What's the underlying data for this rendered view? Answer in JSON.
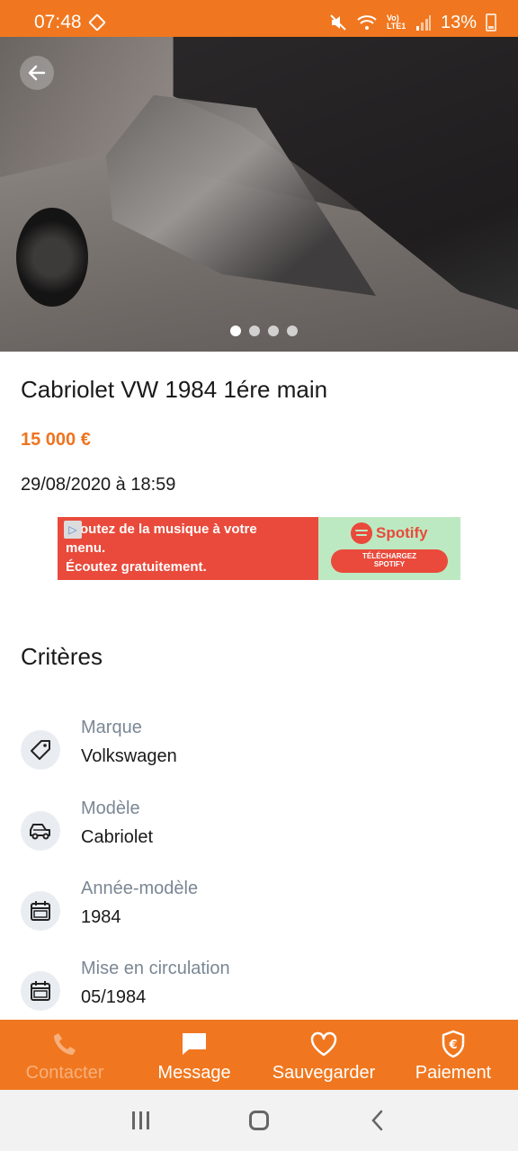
{
  "status_bar": {
    "time": "07:48",
    "battery": "13%",
    "network": "Vo) LTE1",
    "icons": [
      "mute-icon",
      "wifi-icon",
      "signal-icon",
      "battery-icon"
    ]
  },
  "gallery": {
    "image_count": 4,
    "active_index": 0
  },
  "listing": {
    "title": "Cabriolet VW 1984 1ére main",
    "price": "15 000 €",
    "date": "29/08/2020 à 18:59"
  },
  "ad": {
    "line1": "outez de la musique à votre",
    "line2": "menu.",
    "line3": "Écoutez gratuitement.",
    "brand": "Spotify",
    "cta_line1": "TÉLÉCHARGEZ",
    "cta_line2": "SPOTIFY"
  },
  "criteria": {
    "title": "Critères",
    "items": [
      {
        "label": "Marque",
        "value": "Volkswagen",
        "icon": "tag-icon"
      },
      {
        "label": "Modèle",
        "value": "Cabriolet",
        "icon": "car-icon"
      },
      {
        "label": "Année-modèle",
        "value": "1984",
        "icon": "calendar-icon"
      },
      {
        "label": "Mise en circulation",
        "value": "05/1984",
        "icon": "calendar-icon"
      }
    ]
  },
  "actions": {
    "contact": "Contacter",
    "message": "Message",
    "save": "Sauvegarder",
    "payment": "Paiement"
  },
  "colors": {
    "brand": "#f0771f",
    "price": "#ee7420",
    "label": "#7a8794"
  }
}
